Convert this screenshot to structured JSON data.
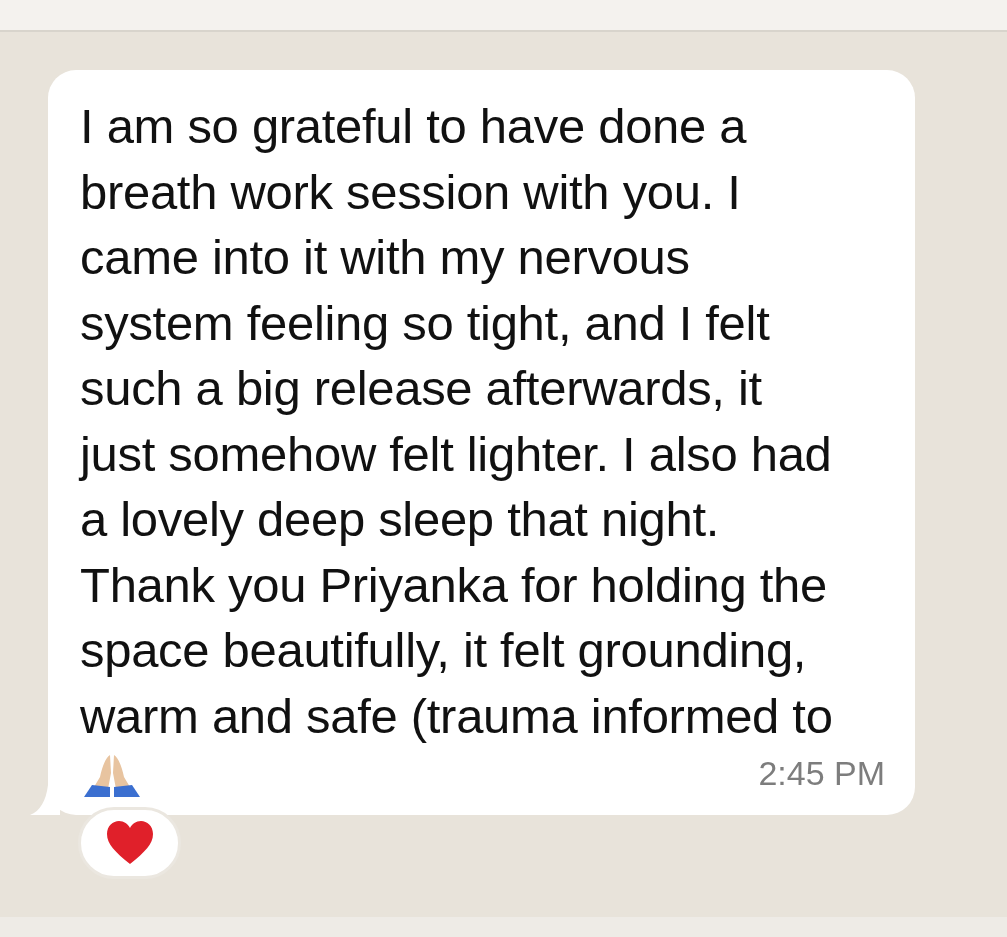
{
  "message": {
    "text": "I am so grateful to have done a\nbreath work session with you. I\ncame into it with my nervous\nsystem feeling so tight, and I felt\nsuch a big release afterwards, it\njust somehow felt lighter. I also had\na lovely deep sleep that night.\nThank you Priyanka for holding the\nspace beautifully, it felt grounding,\nwarm and safe (trauma informed to",
    "time": "2:45 PM",
    "reactions": [
      {
        "kind": "heart"
      }
    ]
  }
}
